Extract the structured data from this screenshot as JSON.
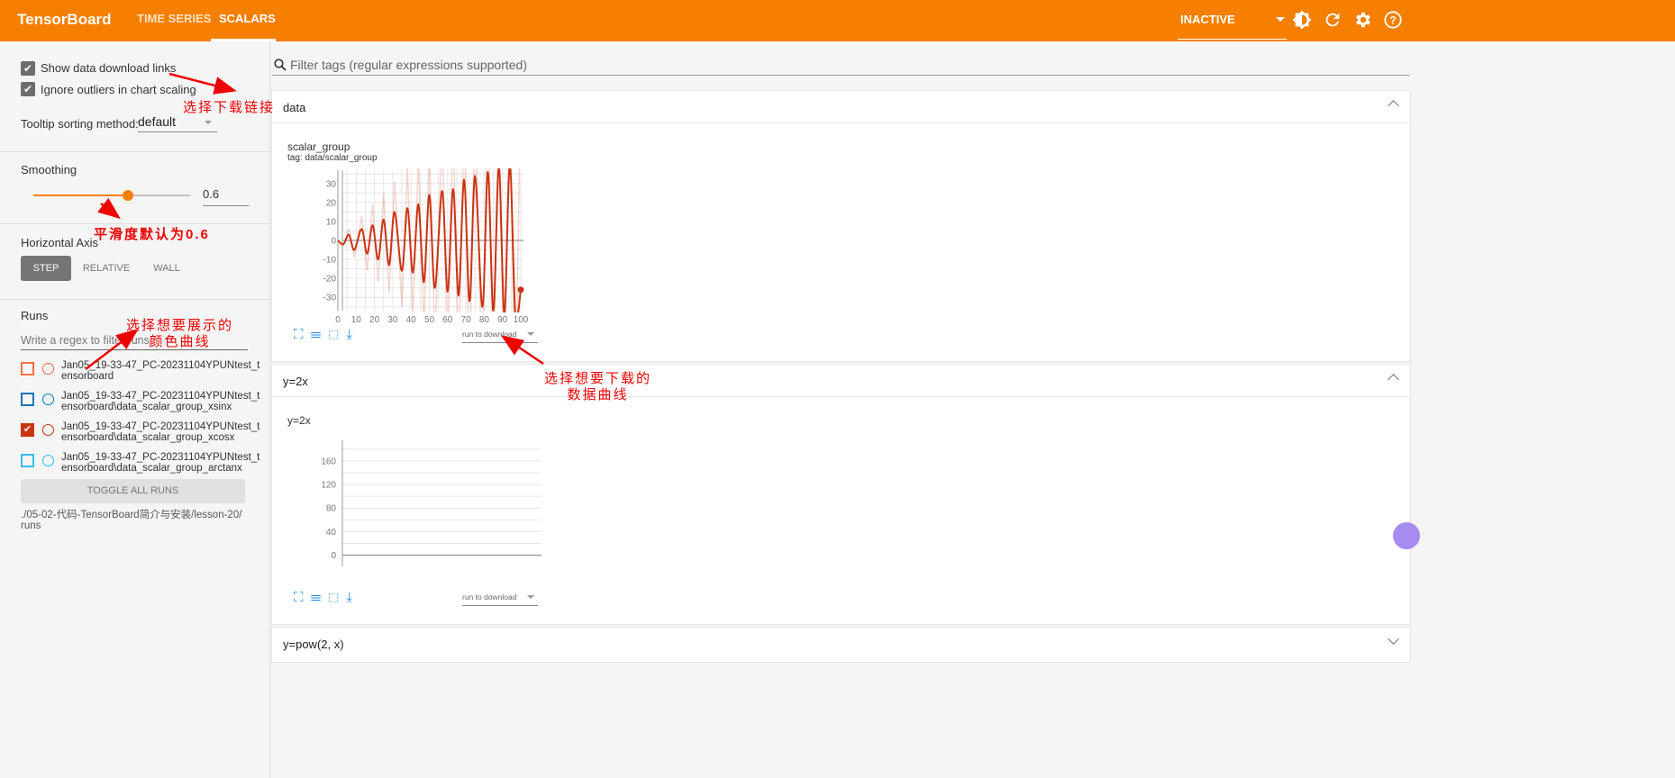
{
  "header": {
    "brand": "TensorBoard",
    "tabs": [
      "TIME SERIES",
      "SCALARS"
    ],
    "active_tab": "SCALARS",
    "run_select": "INACTIVE",
    "accent": "#f77f00",
    "icons": [
      "theme-brightness-icon",
      "reload-icon",
      "settings-gear-icon",
      "help-icon"
    ]
  },
  "sidebar": {
    "show_download": "Show data download links",
    "show_download_checked": true,
    "ignore_outliers": "Ignore outliers in chart scaling",
    "ignore_outliers_checked": true,
    "tooltip_label": "Tooltip sorting method:",
    "tooltip_value": "default",
    "smoothing_label": "Smoothing",
    "smoothing_value": "0.6",
    "smoothing": 0.6,
    "haxis_label": "Horizontal Axis",
    "haxis_options": [
      "STEP",
      "RELATIVE",
      "WALL"
    ],
    "haxis_selected": "STEP",
    "runs_label": "Runs",
    "runs_filter_placeholder": "Write a regex to filter runs",
    "runs": [
      {
        "line1": "Jan05_19-33-47_PC-20231104YPUNtest_t",
        "line2": "ensorboard",
        "color": "#ff7043",
        "checked": false
      },
      {
        "line1": "Jan05_19-33-47_PC-20231104YPUNtest_t",
        "line2": "ensorboard\\data_scalar_group_xsinx",
        "color": "#0077bb",
        "checked": false
      },
      {
        "line1": "Jan05_19-33-47_PC-20231104YPUNtest_t",
        "line2": "ensorboard\\data_scalar_group_xcosx",
        "color": "#cc3311",
        "checked": true
      },
      {
        "line1": "Jan05_19-33-47_PC-20231104YPUNtest_t",
        "line2": "ensorboard\\data_scalar_group_arctanx",
        "color": "#33bbee",
        "checked": false
      }
    ],
    "toggle_all": "TOGGLE ALL RUNS",
    "logdir_line1": "./05-02-代码-TensorBoard简介与安装/lesson-20/",
    "logdir_line2": "runs"
  },
  "main": {
    "filter_placeholder": "Filter tags (regular expressions supported)",
    "sections": [
      {
        "title": "data",
        "expanded": true,
        "card_title": "scalar_group",
        "card_tag": "tag: data/scalar_group",
        "download_select": "run to download"
      },
      {
        "title": "y=2x",
        "expanded": true,
        "card_title": "y=2x",
        "download_select": "run to download"
      },
      {
        "title": "y=pow(2, x)",
        "expanded": false
      }
    ],
    "card_icons": [
      "fullscreen-icon",
      "list-icon",
      "fit-domain-icon",
      "download-icon"
    ]
  },
  "annotations": [
    {
      "text": "选择下载链接"
    },
    {
      "text": "平滑度默认为0.6"
    },
    {
      "line1": "选择想要展示的",
      "line2": "颜色曲线"
    },
    {
      "line1": "选择想要下载的",
      "line2": "数据曲线"
    }
  ],
  "chart_data": [
    {
      "type": "line",
      "title": "scalar_group",
      "xlim": [
        0,
        100
      ],
      "ylim": [
        -37,
        37
      ],
      "xticks": [
        0,
        10,
        20,
        30,
        40,
        50,
        60,
        70,
        80,
        90,
        100
      ],
      "yticks": [
        -30,
        -20,
        -10,
        0,
        10,
        20,
        30
      ],
      "grid": true,
      "color": "#cc3311",
      "smoothed": {
        "x": [
          0,
          3,
          6,
          9,
          13,
          16,
          19,
          22,
          25,
          28,
          31,
          35,
          38,
          41,
          44,
          47,
          50,
          53,
          57,
          60,
          63,
          66,
          69,
          72,
          75,
          79,
          82,
          85,
          88,
          91,
          94,
          97,
          100
        ],
        "y": [
          0,
          -2,
          3,
          -5,
          6,
          -7,
          8,
          -10,
          11,
          -13,
          15,
          -16,
          17,
          -17,
          19,
          -22,
          24,
          -25,
          26,
          -27,
          27,
          -29,
          32,
          -32,
          34,
          -35,
          36,
          -37,
          38,
          -38,
          39,
          -39,
          -26
        ]
      },
      "raw": {
        "x": [
          0,
          3,
          6,
          9,
          13,
          16,
          19,
          22,
          25,
          28,
          31,
          35,
          38,
          41,
          44,
          47,
          50,
          53,
          57,
          60,
          63,
          66,
          69,
          72,
          75,
          79,
          82,
          85,
          88,
          91,
          94,
          97,
          100
        ],
        "y": [
          0,
          -3,
          6,
          -9,
          13,
          -16,
          19,
          -22,
          25,
          -28,
          31,
          -35,
          38,
          -41,
          44,
          -47,
          50,
          -53,
          57,
          -60,
          63,
          -66,
          69,
          -72,
          75,
          -79,
          82,
          -85,
          88,
          -91,
          94,
          -97,
          86
        ]
      }
    },
    {
      "type": "line",
      "title": "y=2x",
      "ylim": [
        -19,
        195
      ],
      "yticks": [
        0,
        40,
        80,
        120,
        160
      ],
      "grid": true
    }
  ]
}
